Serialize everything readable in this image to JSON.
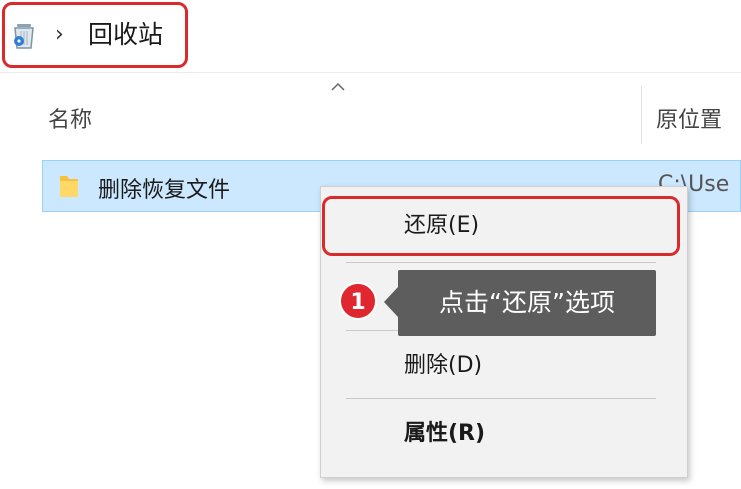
{
  "address_bar": {
    "icon": "recycle-bin-icon",
    "separator": "›",
    "location": "回收站"
  },
  "columns": {
    "name": "名称",
    "original_location": "原位置"
  },
  "files": [
    {
      "name": "删除恢复文件",
      "original_location": "C:\\Use",
      "icon": "folder-icon",
      "selected": true
    }
  ],
  "context_menu": {
    "items": [
      {
        "label": "还原(E)"
      },
      {
        "label": "删除(D)"
      },
      {
        "label": "属性(R)",
        "bold": true
      }
    ]
  },
  "annotation": {
    "step": "1",
    "text": "点击“还原”选项"
  },
  "colors": {
    "highlight": "#d92b2b",
    "selection": "#cce8ff",
    "badge": "#e0262f",
    "tooltip": "#5d5d5d"
  }
}
